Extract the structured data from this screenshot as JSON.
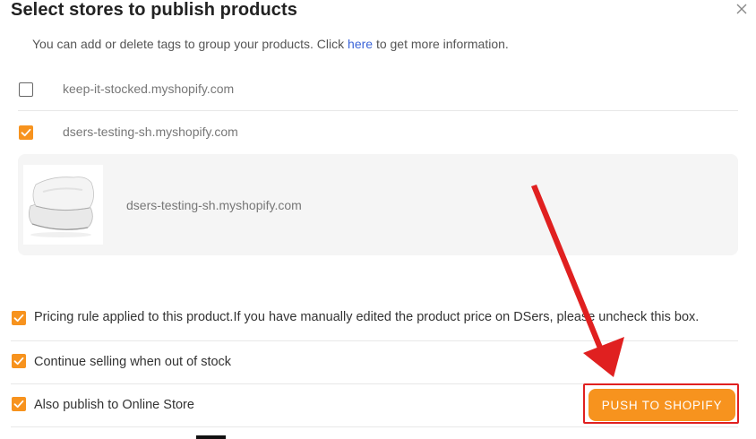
{
  "dialog": {
    "title": "Select stores to publish products",
    "info_prefix": "You can add or delete tags to group your products. Click ",
    "info_link": "here",
    "info_suffix": " to get more information."
  },
  "stores": [
    {
      "label": "keep-it-stocked.myshopify.com",
      "checked": false
    },
    {
      "label": "dsers-testing-sh.myshopify.com",
      "checked": true
    }
  ],
  "product_card": {
    "store_label": "dsers-testing-sh.myshopify.com",
    "image": "pillow-product-image"
  },
  "options": [
    {
      "label": "Pricing rule applied to this product.If you have manually edited the product price on DSers, please uncheck this box.",
      "checked": true
    },
    {
      "label": "Continue selling when out of stock",
      "checked": true
    },
    {
      "label": "Also publish to Online Store",
      "checked": true
    }
  ],
  "push_button": {
    "label": "PUSH TO SHOPIFY"
  },
  "colors": {
    "accent": "#f7931e",
    "link": "#3b64d8",
    "annotation": "#e02020"
  }
}
